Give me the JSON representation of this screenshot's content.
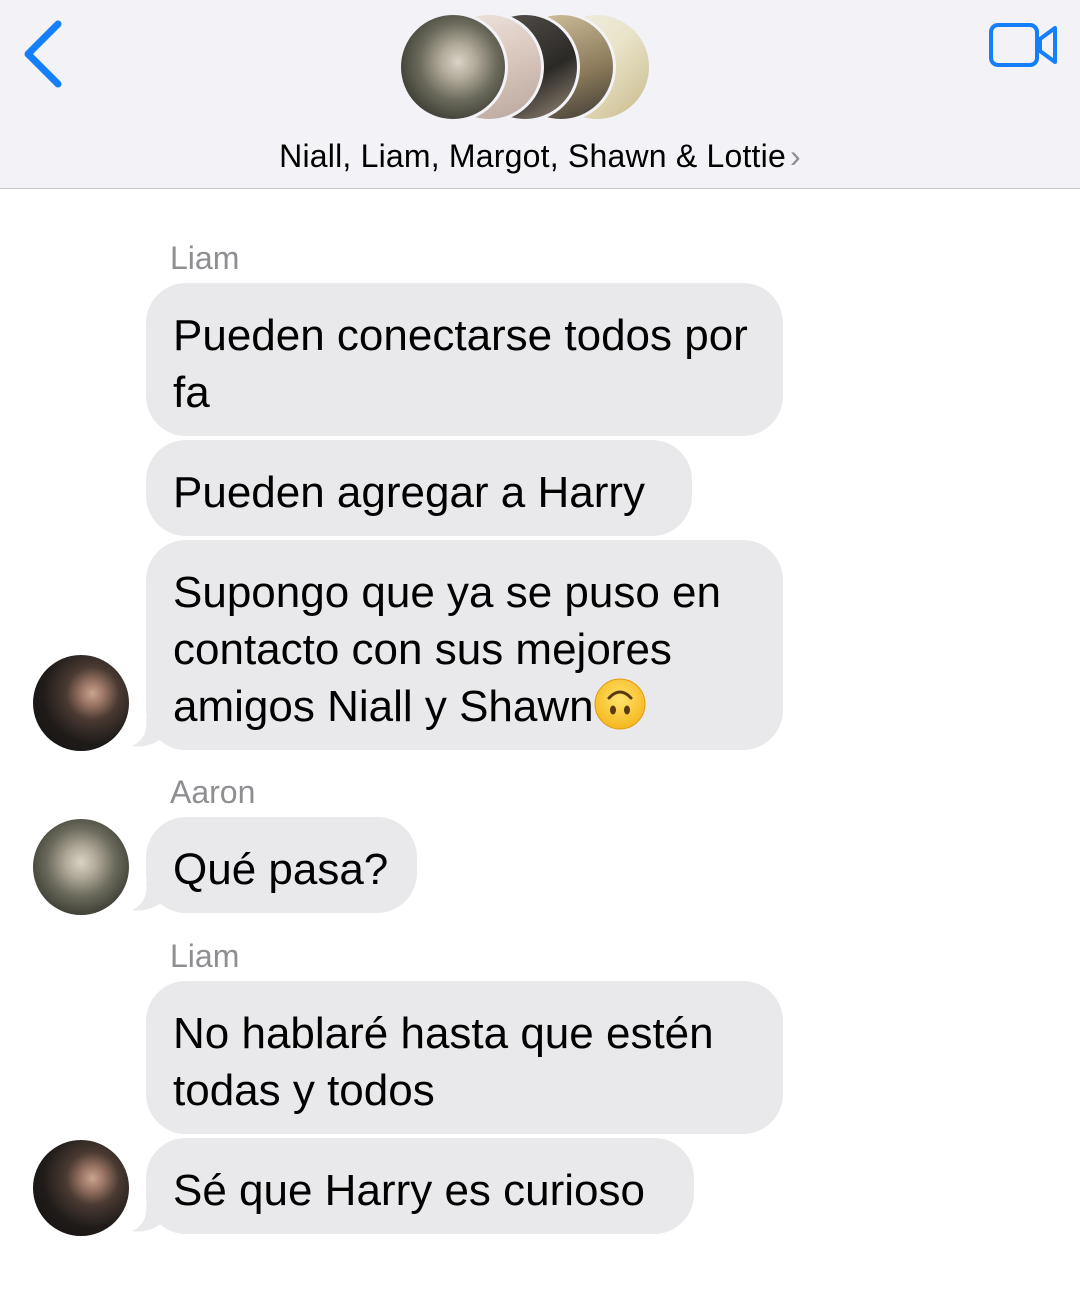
{
  "header": {
    "back_icon": "chevron-left-icon",
    "video_icon": "video-camera-icon",
    "group_title": "Niall, Liam, Margot, Shawn & Lottie",
    "title_chevron": "›",
    "accent_color": "#147efb"
  },
  "messages": [
    {
      "sender": "Liam",
      "text": "Pueden conectarse todos por fa"
    },
    {
      "text": "Pueden agregar a Harry"
    },
    {
      "text": "Supongo que ya se puso en contacto con sus mejores amigos Niall y Shawn",
      "emoji": "upside-down-face-icon"
    },
    {
      "sender": "Aaron",
      "text": "Qué pasa?"
    },
    {
      "sender": "Liam",
      "text": "No hablaré hasta que estén todas y todos"
    },
    {
      "text": "Sé que Harry es curioso"
    }
  ]
}
